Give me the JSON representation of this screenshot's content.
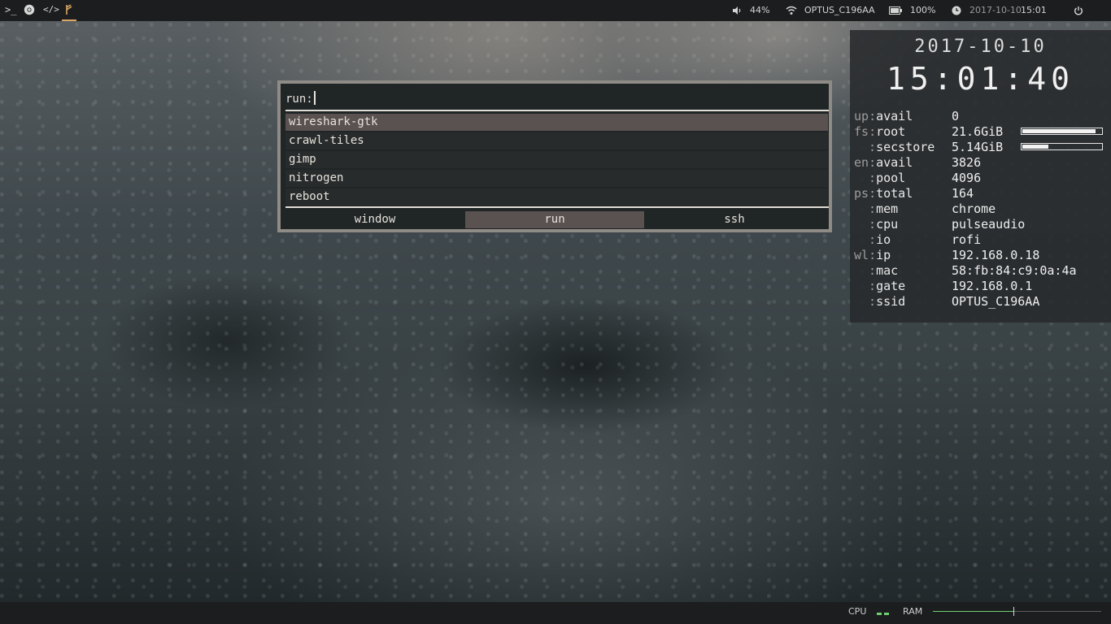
{
  "topbar": {
    "launchers": [
      {
        "icon": "terminal-icon",
        "glyph": ">_"
      },
      {
        "icon": "chrome-icon",
        "glyph": "◉"
      },
      {
        "icon": "code-icon",
        "glyph": "</>"
      },
      {
        "icon": "git-branch-icon",
        "glyph": "ᚠ"
      }
    ],
    "volume": "44%",
    "wifi_ssid": "OPTUS_C196AA",
    "battery": "100%",
    "date": "2017-10-10",
    "time": "15:01"
  },
  "rofi": {
    "prompt": "run:",
    "input_value": "",
    "items": [
      "wireshark-gtk",
      "crawl-tiles",
      "gimp",
      "nitrogen",
      "reboot"
    ],
    "selected_index": 0,
    "modes": [
      "window",
      "run",
      "ssh"
    ],
    "active_mode": "run"
  },
  "conky": {
    "date": "2017-10-10",
    "time": "15:01:40",
    "rows": [
      {
        "prefix": "up",
        "key": "avail",
        "value": "0"
      },
      {
        "prefix": "fs",
        "key": "root",
        "value": "21.6GiB",
        "bar_fraction": 0.93
      },
      {
        "prefix": "",
        "key": "secstore",
        "value": "5.14GiB",
        "bar_fraction": 0.33
      },
      {
        "prefix": "en",
        "key": "avail",
        "value": "3826"
      },
      {
        "prefix": "",
        "key": "pool",
        "value": "4096"
      },
      {
        "prefix": "ps",
        "key": "total",
        "value": "164"
      },
      {
        "prefix": "",
        "key": "mem",
        "value": "chrome"
      },
      {
        "prefix": "",
        "key": "cpu",
        "value": "pulseaudio"
      },
      {
        "prefix": "",
        "key": "io",
        "value": "rofi"
      },
      {
        "prefix": "wl",
        "key": "ip",
        "value": "192.168.0.18"
      },
      {
        "prefix": "",
        "key": "mac",
        "value": "58:fb:84:c9:0a:4a"
      },
      {
        "prefix": "",
        "key": "gate",
        "value": "192.168.0.1"
      },
      {
        "prefix": "",
        "key": "ssid",
        "value": "OPTUS_C196AA"
      }
    ]
  },
  "bottombar": {
    "cpu_label": "CPU",
    "ram_label": "RAM",
    "ram_fraction": 0.48,
    "accent": "#6fcf6f"
  }
}
